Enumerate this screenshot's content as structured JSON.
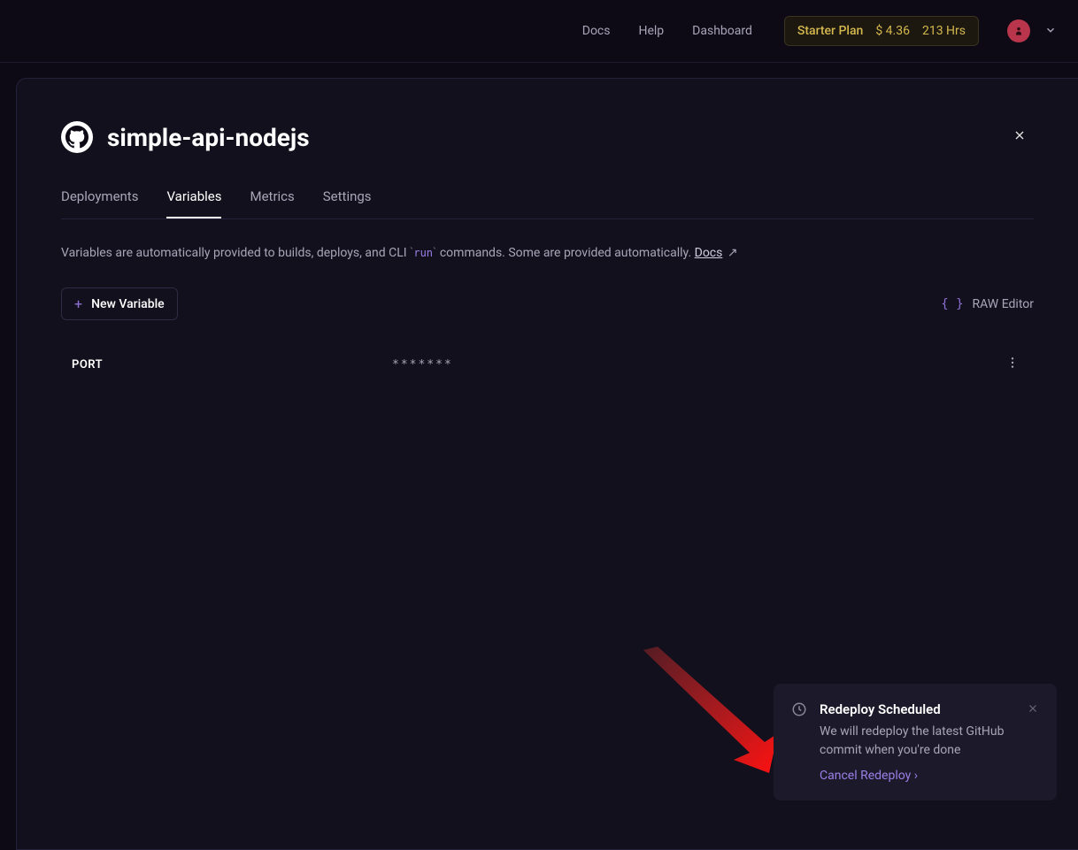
{
  "header": {
    "nav": {
      "docs": "Docs",
      "help": "Help",
      "dashboard": "Dashboard"
    },
    "plan": {
      "name": "Starter Plan",
      "cost": "$ 4.36",
      "hours": "213 Hrs"
    }
  },
  "project": {
    "title": "simple-api-nodejs"
  },
  "tabs": {
    "deployments": "Deployments",
    "variables": "Variables",
    "metrics": "Metrics",
    "settings": "Settings"
  },
  "description": {
    "prefix": "Variables are automatically provided to builds, deploys, and CLI ",
    "code": "run",
    "suffix": " commands. Some are provided automatically. ",
    "docs_label": "Docs"
  },
  "toolbar": {
    "new_variable": "New Variable",
    "raw_editor": "RAW Editor"
  },
  "variables": [
    {
      "name": "PORT",
      "value": "*******"
    }
  ],
  "toast": {
    "title": "Redeploy Scheduled",
    "body": "We will redeploy the latest GitHub commit when you're done",
    "action": "Cancel Redeploy ›"
  }
}
